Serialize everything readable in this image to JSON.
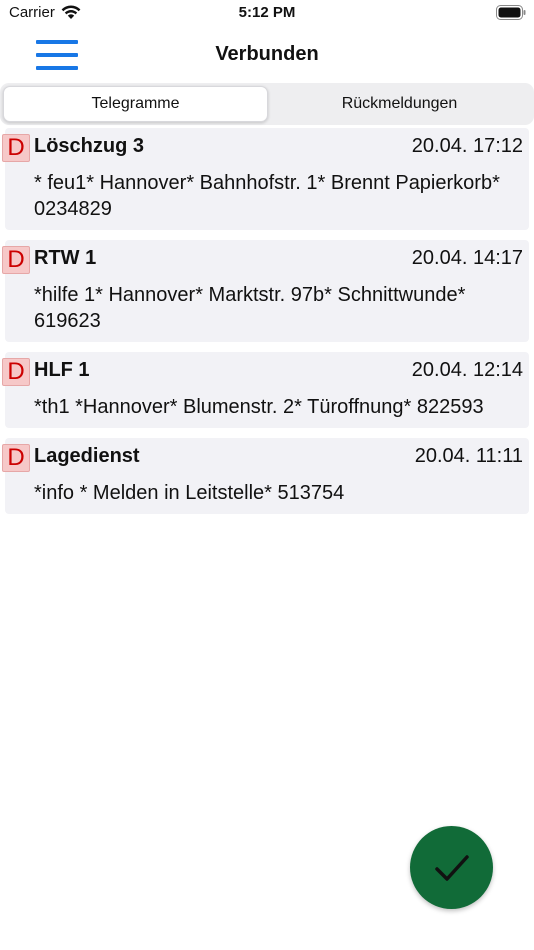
{
  "status_bar": {
    "carrier": "Carrier",
    "time": "5:12 PM"
  },
  "nav": {
    "title": "Verbunden",
    "menu_icon": "hamburger-menu-icon",
    "accent": "#1877e6"
  },
  "segments": [
    {
      "label": "Telegramme",
      "selected": true
    },
    {
      "label": "Rückmeldungen",
      "selected": false
    }
  ],
  "messages": [
    {
      "badge": "D",
      "unit": "Löschzug 3",
      "time": "20.04. 17:12",
      "text": "* feu1* Hannover* Bahnhofstr. 1* Brennt Papierkorb* 0234829"
    },
    {
      "badge": "D",
      "unit": "RTW 1",
      "time": "20.04. 14:17",
      "text": "*hilfe 1* Hannover* Marktstr. 97b* Schnittwunde* 619623"
    },
    {
      "badge": "D",
      "unit": "HLF 1",
      "time": "20.04. 12:14",
      "text": "*th1 *Hannover* Blumenstr. 2* Türoffnung* 822593"
    },
    {
      "badge": "D",
      "unit": "Lagedienst",
      "time": "20.04.  11:11",
      "text": "*info * Melden in Leitstelle* 513754"
    }
  ],
  "fab": {
    "icon": "checkmark-icon",
    "color": "#116b38"
  }
}
